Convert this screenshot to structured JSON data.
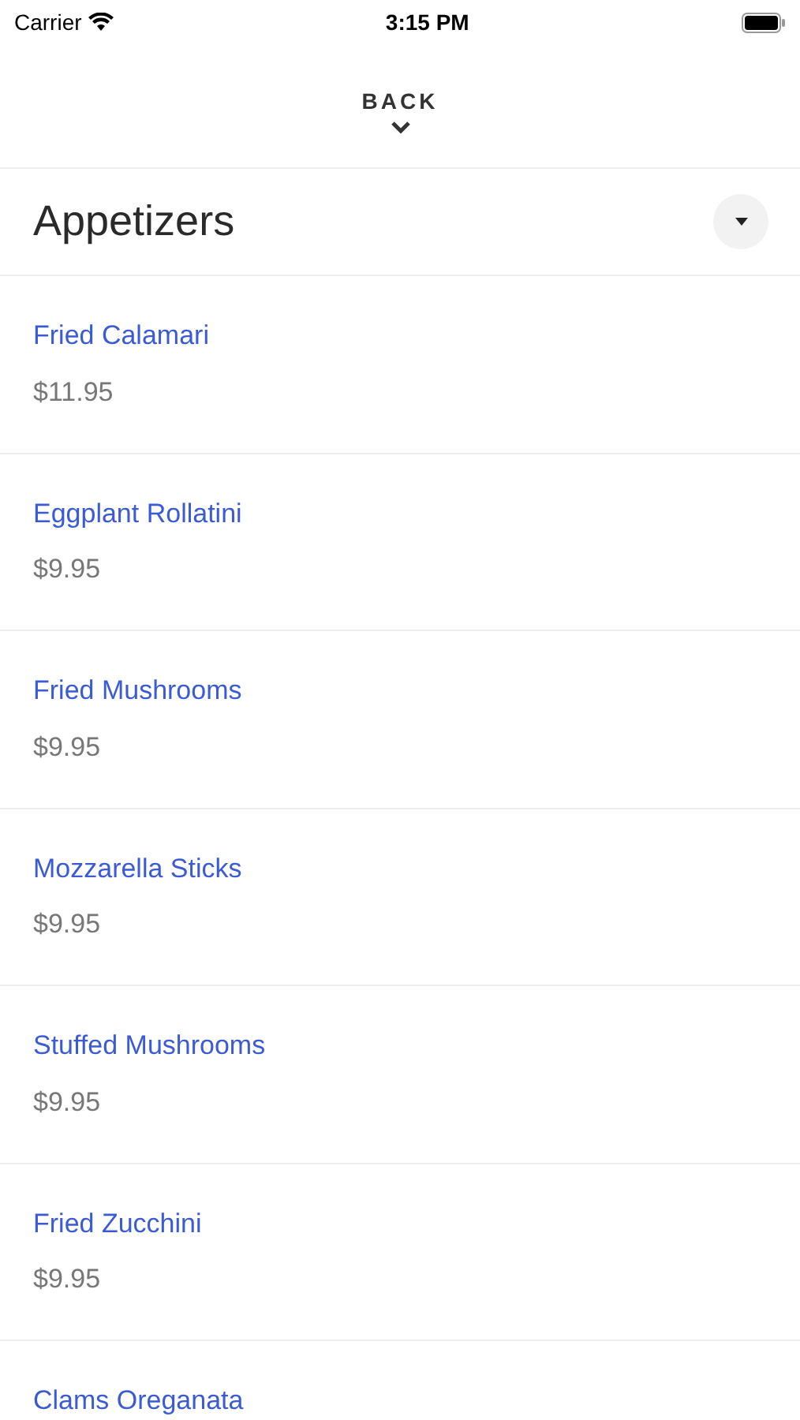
{
  "status_bar": {
    "carrier": "Carrier",
    "time": "3:15 PM"
  },
  "back": {
    "label": "BACK"
  },
  "section": {
    "title": "Appetizers"
  },
  "items": [
    {
      "name": "Fried Calamari",
      "price": "$11.95"
    },
    {
      "name": "Eggplant Rollatini",
      "price": "$9.95"
    },
    {
      "name": "Fried Mushrooms",
      "price": "$9.95"
    },
    {
      "name": "Mozzarella Sticks",
      "price": "$9.95"
    },
    {
      "name": "Stuffed Mushrooms",
      "price": "$9.95"
    },
    {
      "name": "Fried Zucchini",
      "price": "$9.95"
    },
    {
      "name": "Clams Oreganata"
    }
  ]
}
